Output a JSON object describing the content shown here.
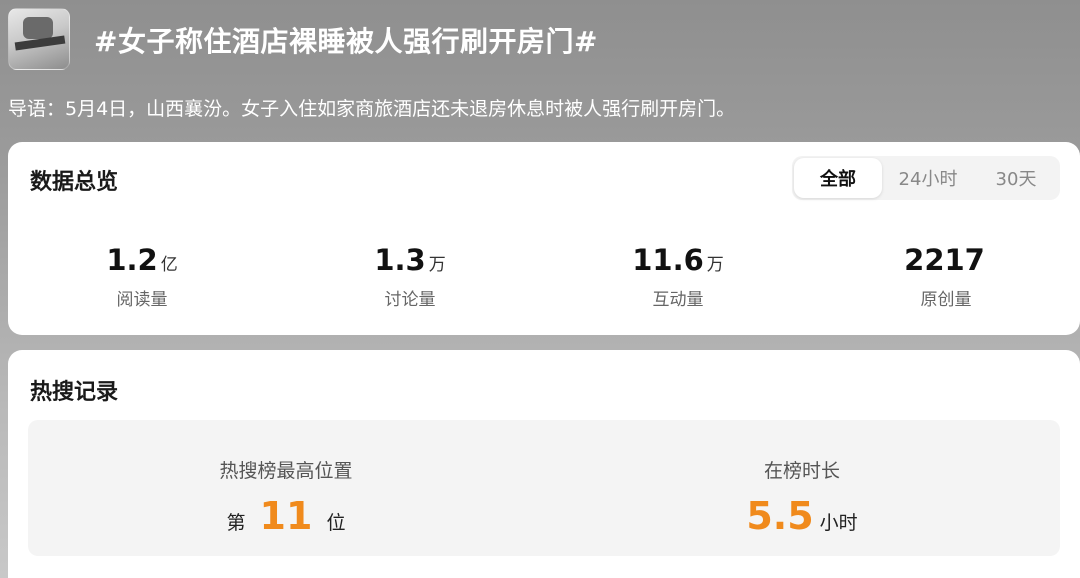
{
  "topic": {
    "title": "#女子称住酒店裸睡被人强行刷开房门#",
    "intro": "导语：5月4日，山西襄汾。女子入住如家商旅酒店还未退房休息时被人强行刷开房门。"
  },
  "overview": {
    "title": "数据总览",
    "tabs": [
      {
        "label": "全部",
        "active": true
      },
      {
        "label": "24小时",
        "active": false
      },
      {
        "label": "30天",
        "active": false
      }
    ],
    "stats": [
      {
        "value": "1.2",
        "unit": "亿",
        "label": "阅读量"
      },
      {
        "value": "1.3",
        "unit": "万",
        "label": "讨论量"
      },
      {
        "value": "11.6",
        "unit": "万",
        "label": "互动量"
      },
      {
        "value": "2217",
        "unit": "",
        "label": "原创量"
      }
    ]
  },
  "hot_search": {
    "title": "热搜记录",
    "highest_position": {
      "label": "热搜榜最高位置",
      "prefix": "第",
      "value": "11",
      "suffix": "位"
    },
    "duration": {
      "label": "在榜时长",
      "value": "5.5",
      "suffix": "小时"
    }
  },
  "colors": {
    "accent": "#f08a1c"
  }
}
